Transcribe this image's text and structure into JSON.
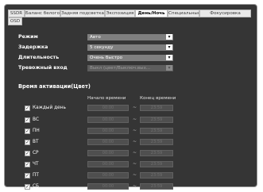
{
  "tabs": [
    {
      "label": "SSDR",
      "active": false
    },
    {
      "label": "Баланс белого",
      "active": false
    },
    {
      "label": "Задняя подсветка",
      "active": false
    },
    {
      "label": "Экспозиция",
      "active": false
    },
    {
      "label": "День/Ночь",
      "active": true
    },
    {
      "label": "Специальные",
      "active": false
    },
    {
      "label": "Фокусировка",
      "active": false
    },
    {
      "label": "OSD",
      "active": false
    }
  ],
  "settings": [
    {
      "label": "Режим",
      "value": "Авто",
      "disabled": false
    },
    {
      "label": "Задержка",
      "value": "5 секунду",
      "disabled": false
    },
    {
      "label": "Длительность",
      "value": "Очень быстро",
      "disabled": false
    },
    {
      "label": "Тревожный вход",
      "value": "Выкл (цвет/Выключ.вых...",
      "disabled": true
    }
  ],
  "schedule": {
    "title": "Время активации(Цвет)",
    "start_header": "Начало времени",
    "end_header": "Конец времени",
    "separator": "~",
    "start_value": "00:00",
    "end_value": "23:59",
    "days": [
      {
        "label": "Каждый день",
        "checked": true
      },
      {
        "label": "ВС",
        "checked": true
      },
      {
        "label": "ПН",
        "checked": true
      },
      {
        "label": "ВТ",
        "checked": true
      },
      {
        "label": "СР",
        "checked": true
      },
      {
        "label": "ЧТ",
        "checked": true
      },
      {
        "label": "ПТ",
        "checked": true
      },
      {
        "label": "СБ",
        "checked": true
      }
    ]
  },
  "colors": {
    "panel_bg": "#353535",
    "tab_bg": "#e9e9e9",
    "select_bg": "#7f7f7f"
  }
}
